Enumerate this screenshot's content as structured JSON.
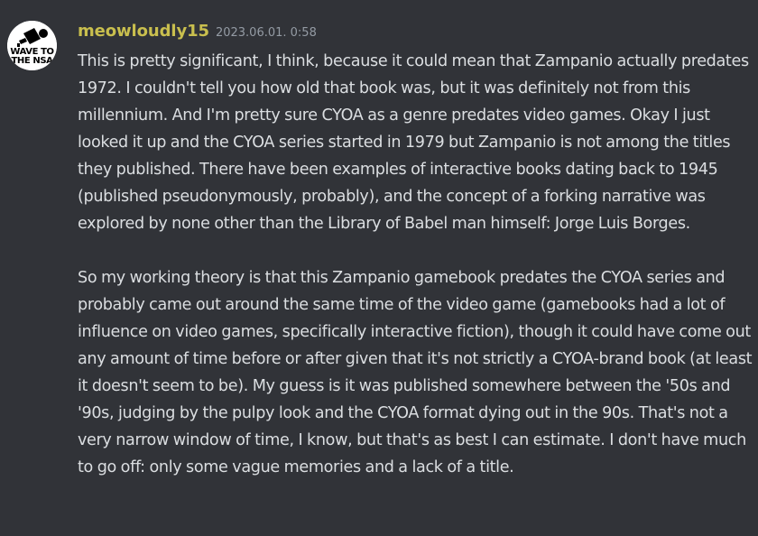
{
  "message": {
    "avatar": {
      "text_line1": "WAVE TO",
      "text_line2": "THE NSA",
      "icon": "camera-icon"
    },
    "username": "meowloudly15",
    "timestamp": "2023.06.01. 0:58",
    "paragraphs": [
      "This is pretty significant, I think, because it could mean that Zampanio actually predates 1972. I couldn't tell you how old that book was, but it was definitely not from this millennium. And I'm pretty sure CYOA as a genre predates video games. Okay I just looked it up and the CYOA series started in 1979 but Zampanio is not among the titles they published. There have been examples of interactive books dating back to 1945 (published pseudonymously, probably), and the concept of a forking narrative was explored by none other than the Library of Babel man himself: Jorge Luis Borges.",
      "So my working theory is that this Zampanio gamebook predates the CYOA series and probably came out around the same time of the video game (gamebooks had a lot of influence on video games, specifically interactive fiction), though it could have come out any amount of time before or after given that it's not strictly a CYOA-brand book (at least it doesn't seem to be). My guess is it was published somewhere between the '50s and '90s, judging by the pulpy look and the CYOA format dying out in the 90s. That's not a very narrow window of time, I know, but that's as best I can estimate. I don't have much to go off: only some vague memories and a lack of a title."
    ]
  },
  "colors": {
    "background": "#313338",
    "username": "#c9bf4e",
    "text": "#dbdee1",
    "timestamp": "#949ba4"
  }
}
